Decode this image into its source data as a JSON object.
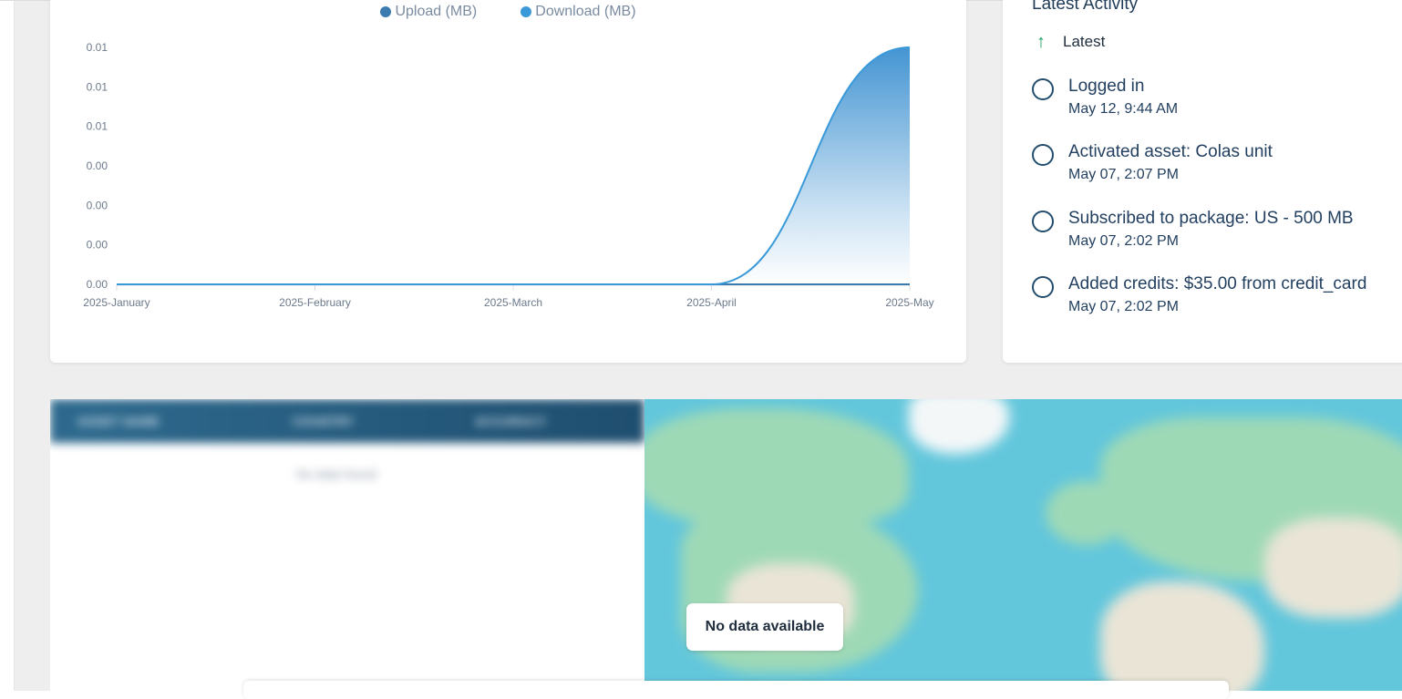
{
  "usage_chart": {
    "legend": [
      {
        "label": "Upload (MB)",
        "color": "#3b7bb0"
      },
      {
        "label": "Download (MB)",
        "color": "#3a9ad9"
      }
    ]
  },
  "chart_data": {
    "type": "area",
    "title": "",
    "xlabel": "",
    "ylabel": "",
    "categories": [
      "2025-January",
      "2025-February",
      "2025-March",
      "2025-April",
      "2025-May"
    ],
    "y_tick_labels": [
      "0.00",
      "0.00",
      "0.00",
      "0.00",
      "0.01",
      "0.01",
      "0.01"
    ],
    "ylim": [
      0,
      0.01
    ],
    "series": [
      {
        "name": "Upload (MB)",
        "values": [
          0,
          0,
          0,
          0,
          0
        ],
        "color": "#3b7bb0"
      },
      {
        "name": "Download (MB)",
        "values": [
          0,
          0,
          0,
          0,
          0.01
        ],
        "color": "#3a9ad9"
      }
    ],
    "legend_position": "top-center",
    "grid": false
  },
  "activity": {
    "title": "Latest Activity",
    "latest_label": "Latest",
    "latest_icon": "arrow-up-icon",
    "items": [
      {
        "label": "Logged in",
        "time": "May 12, 9:44 AM"
      },
      {
        "label": "Activated asset: Colas unit",
        "time": "May 07, 2:07 PM"
      },
      {
        "label": "Subscribed to package: US - 500 MB",
        "time": "May 07, 2:02 PM"
      },
      {
        "label": "Added credits: $35.00 from credit_card",
        "time": "May 07, 2:02 PM"
      }
    ]
  },
  "assets_table": {
    "columns": [
      "ASSET NAME",
      "COUNTRY",
      "ACCURACY"
    ],
    "empty_message": "No data found"
  },
  "map": {
    "no_data_label": "No data available"
  }
}
